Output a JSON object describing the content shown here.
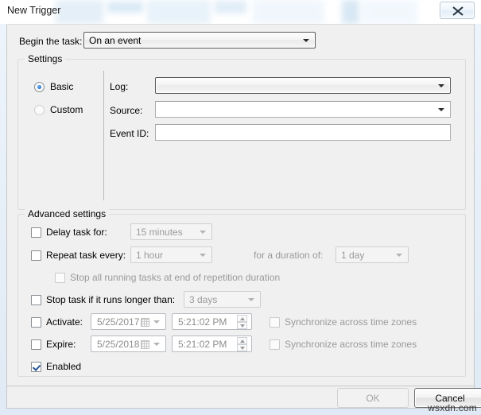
{
  "window": {
    "title": "New Trigger",
    "close_icon": "close-icon"
  },
  "begin": {
    "label": "Begin the task:",
    "value": "On an event"
  },
  "settings": {
    "legend": "Settings",
    "mode": {
      "basic": "Basic",
      "custom": "Custom",
      "selected": "Basic"
    },
    "fields": [
      {
        "label": "Log:",
        "value": "",
        "type": "combo",
        "focused": true
      },
      {
        "label": "Source:",
        "value": "",
        "type": "combo",
        "focused": false
      },
      {
        "label": "Event ID:",
        "value": "",
        "type": "edit",
        "focused": false
      }
    ]
  },
  "advanced": {
    "legend": "Advanced settings",
    "delay": {
      "label": "Delay task for:",
      "checked": false,
      "value": "15 minutes"
    },
    "repeat": {
      "label": "Repeat task every:",
      "checked": false,
      "value": "1 hour",
      "duration_label": "for a duration of:",
      "duration_value": "1 day"
    },
    "stop_all": {
      "label": "Stop all running tasks at end of repetition duration",
      "checked": false
    },
    "stop_longer": {
      "label": "Stop task if it runs longer than:",
      "checked": false,
      "value": "3 days"
    },
    "activate": {
      "label": "Activate:",
      "checked": false,
      "date": "5/25/2017",
      "time": "5:21:02 PM",
      "sync_label": "Synchronize across time zones",
      "sync_checked": false
    },
    "expire": {
      "label": "Expire:",
      "checked": false,
      "date": "5/25/2018",
      "time": "5:21:02 PM",
      "sync_label": "Synchronize across time zones",
      "sync_checked": false
    },
    "enabled": {
      "label": "Enabled",
      "checked": true
    }
  },
  "footer": {
    "ok": "OK",
    "cancel": "Cancel"
  },
  "watermark": "wsxdn.com",
  "colors": {
    "dialog_bg": "#f0f0f0",
    "accent_check": "#2a5699",
    "radio_dot": "#1f6fc4"
  }
}
